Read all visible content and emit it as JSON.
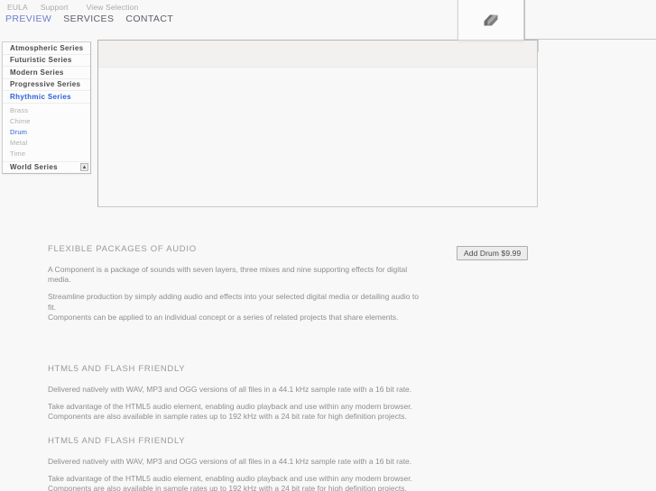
{
  "nav": {
    "utility_links": [
      {
        "label": "EULA"
      },
      {
        "label": "Support"
      },
      {
        "label": "View Selection"
      }
    ],
    "main_links": [
      {
        "label": "PREVIEW",
        "active": true
      },
      {
        "label": "SERVICES",
        "active": false
      },
      {
        "label": "CONTACT",
        "active": false
      }
    ]
  },
  "sidebar": {
    "series": [
      {
        "label": "Atmospheric Series"
      },
      {
        "label": "Futuristic Series"
      },
      {
        "label": "Modern Series"
      },
      {
        "label": "Progressive Series"
      },
      {
        "label": "Rhythmic Series"
      }
    ],
    "selected_series": "Rhythmic Series",
    "sub_items": [
      {
        "label": "Brass"
      },
      {
        "label": "Chime"
      },
      {
        "label": "Drum"
      },
      {
        "label": "Metal"
      },
      {
        "label": "Time"
      }
    ],
    "selected_sub_item": "Drum",
    "last_series": {
      "label": "World Series"
    },
    "resize_glyph": "▲"
  },
  "tool_panel": {
    "icon_name": "layers-icon"
  },
  "sections": [
    {
      "title": "FLEXIBLE PACKAGES OF AUDIO",
      "paragraphs": [
        "A Component is a package of sounds with seven layers, three mixes and nine supporting effects for digital media.",
        "Streamline production by simply adding audio and effects into your selected digital media or detailing audio to fit.",
        "Components can be applied to an individual concept or a series of related projects that share elements."
      ]
    },
    {
      "title": "HTML5 AND FLASH FRIENDLY",
      "paragraphs": [
        "Delivered natively with WAV, MP3 and OGG versions of all files in a 44.1 kHz sample rate with a 16 bit rate.",
        "Take advantage of the HTML5 audio element, enabling audio playback and use within any modern browser.",
        "Components are also available in sample rates up to 192 kHz with a 24 bit rate for high definition projects."
      ]
    },
    {
      "title": "HTML5 AND FLASH FRIENDLY",
      "paragraphs": [
        "Delivered natively with WAV, MP3 and OGG versions of all files in a 44.1 kHz sample rate with a 16 bit rate.",
        "Take advantage of the HTML5 audio element, enabling audio playback and use within any modern browser.",
        "Components are also available in sample rates up to 192 kHz with a 24 bit rate for high definition projects."
      ]
    }
  ],
  "add_button": {
    "label": "Add Drum $9.99"
  },
  "colors": {
    "accent_blue": "#2b5fd9",
    "nav_active": "#6c7fd4",
    "body_text": "#8e8e8e",
    "page_background": "#f8f8f8"
  }
}
